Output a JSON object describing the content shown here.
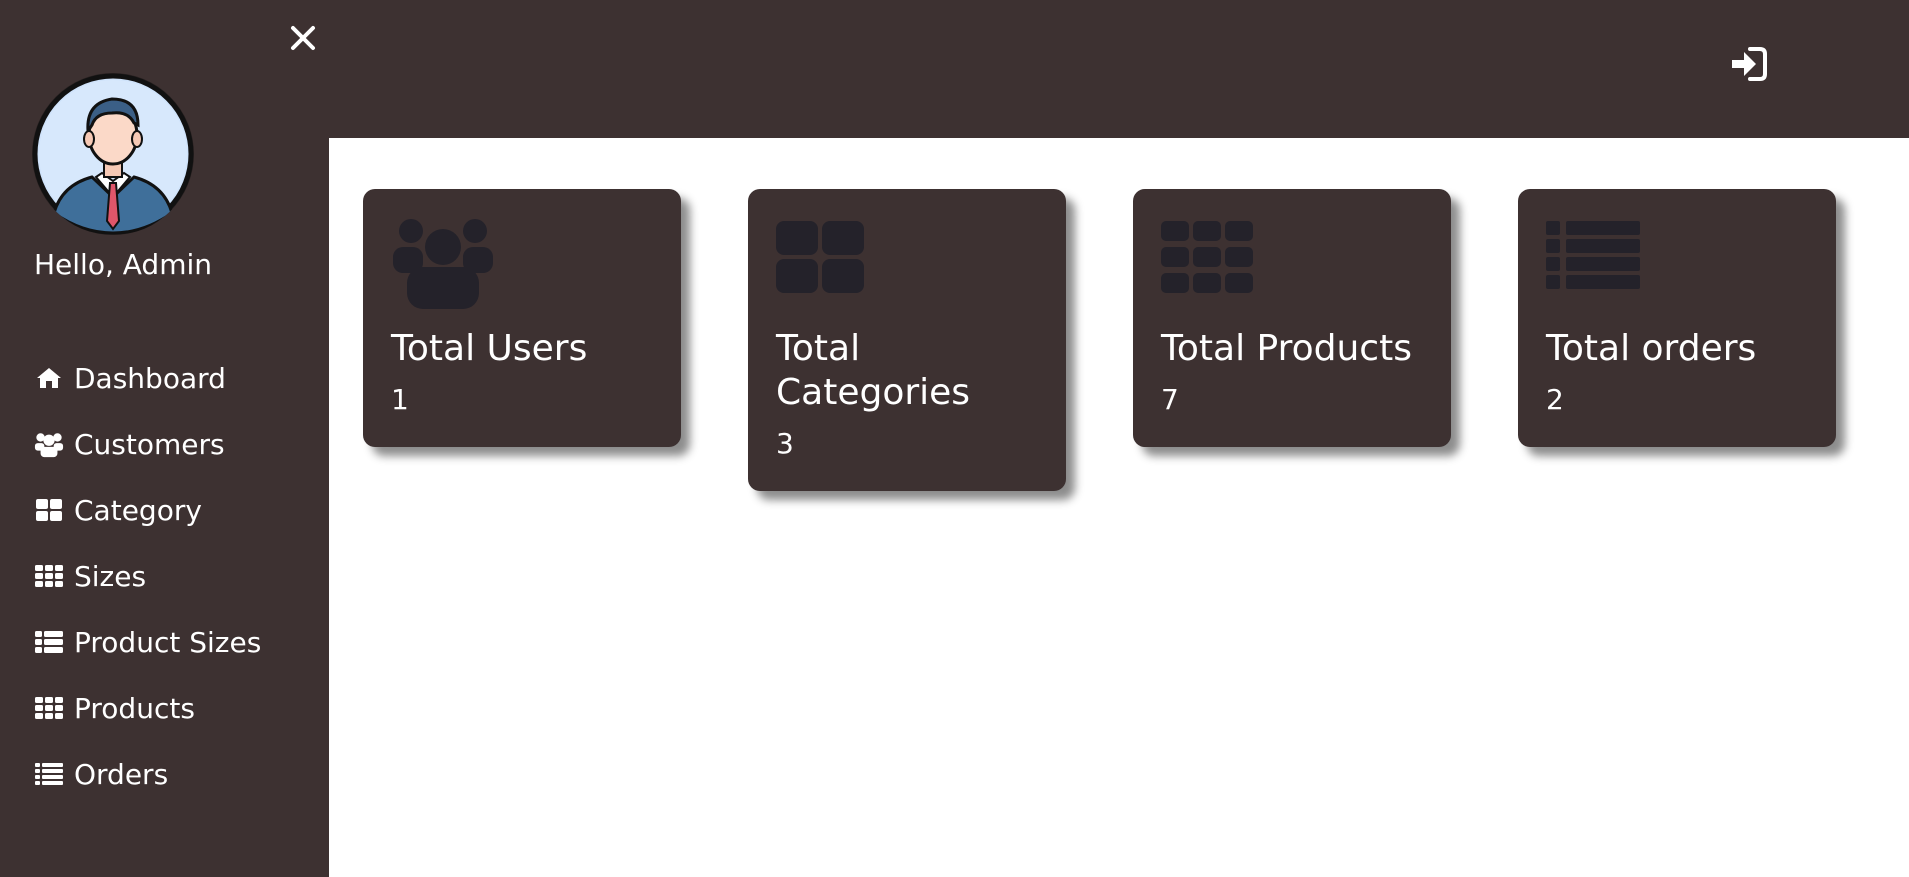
{
  "sidebar": {
    "close_icon": "close-icon",
    "avatar_icon": "user-avatar",
    "greeting": "Hello, Admin",
    "items": [
      {
        "label": "Dashboard",
        "icon": "home-icon"
      },
      {
        "label": "Customers",
        "icon": "users-icon"
      },
      {
        "label": "Category",
        "icon": "th-large-icon"
      },
      {
        "label": "Sizes",
        "icon": "th-icon"
      },
      {
        "label": "Product Sizes",
        "icon": "th-list-icon"
      },
      {
        "label": "Products",
        "icon": "th-icon"
      },
      {
        "label": "Orders",
        "icon": "list-icon"
      }
    ]
  },
  "topbar": {
    "logout_icon": "sign-in-icon"
  },
  "cards": [
    {
      "title": "Total Users",
      "value": "1",
      "icon": "users-icon"
    },
    {
      "title": "Total Categories",
      "value": "3",
      "icon": "th-large-icon"
    },
    {
      "title": "Total Products",
      "value": "7",
      "icon": "th-icon"
    },
    {
      "title": "Total orders",
      "value": "2",
      "icon": "th-list-icon"
    }
  ],
  "colors": {
    "panel": "#3d3131",
    "card_icon": "#24222a",
    "text": "#ffffff"
  }
}
